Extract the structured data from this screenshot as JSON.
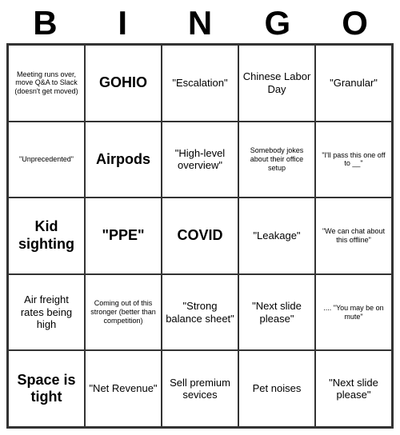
{
  "title": {
    "letters": [
      "B",
      "I",
      "N",
      "G",
      "O"
    ]
  },
  "cells": [
    {
      "text": "Meeting runs over, move Q&A to Slack (doesn't get moved)",
      "size": "small"
    },
    {
      "text": "GOHIO",
      "size": "large"
    },
    {
      "text": "\"Escalation\"",
      "size": "medium"
    },
    {
      "text": "Chinese Labor Day",
      "size": "medium"
    },
    {
      "text": "\"Granular\"",
      "size": "medium"
    },
    {
      "text": "\"Unprecedented\"",
      "size": "small"
    },
    {
      "text": "Airpods",
      "size": "large"
    },
    {
      "text": "\"High-level overview\"",
      "size": "medium"
    },
    {
      "text": "Somebody jokes about their office setup",
      "size": "small"
    },
    {
      "text": "\"I'll pass this one off to __\"",
      "size": "small"
    },
    {
      "text": "Kid sighting",
      "size": "large"
    },
    {
      "text": "\"PPE\"",
      "size": "large"
    },
    {
      "text": "COVID",
      "size": "large"
    },
    {
      "text": "\"Leakage\"",
      "size": "medium"
    },
    {
      "text": "\"We can chat about this offline\"",
      "size": "small"
    },
    {
      "text": "Air freight rates being high",
      "size": "medium"
    },
    {
      "text": "Coming out of this stronger (better than competition)",
      "size": "small"
    },
    {
      "text": "\"Strong balance sheet\"",
      "size": "medium"
    },
    {
      "text": "\"Next slide please\"",
      "size": "medium"
    },
    {
      "text": ".... \"You may be on mute\"",
      "size": "small"
    },
    {
      "text": "Space is tight",
      "size": "large"
    },
    {
      "text": "\"Net Revenue\"",
      "size": "medium"
    },
    {
      "text": "Sell premium sevices",
      "size": "medium"
    },
    {
      "text": "Pet noises",
      "size": "medium"
    },
    {
      "text": "\"Next slide please\"",
      "size": "medium"
    }
  ]
}
